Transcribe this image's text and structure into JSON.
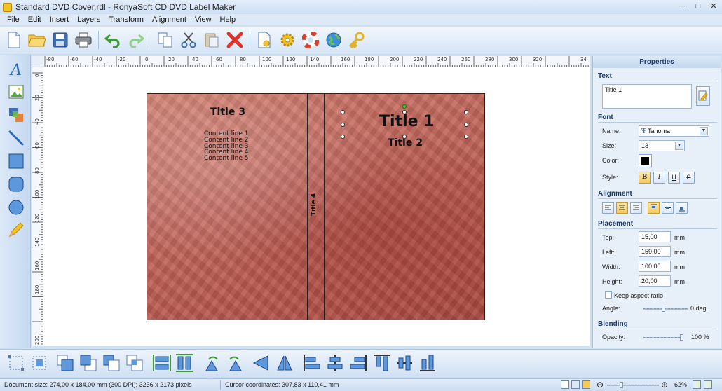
{
  "window": {
    "title": "Standard DVD Cover.rdl - RonyaSoft CD DVD Label Maker",
    "minimize": "─",
    "maximize": "□",
    "close": "✕"
  },
  "menu": [
    "File",
    "Edit",
    "Insert",
    "Layers",
    "Transform",
    "Alignment",
    "View",
    "Help"
  ],
  "toolbar": [
    {
      "name": "new-icon"
    },
    {
      "name": "open-icon"
    },
    {
      "name": "save-icon"
    },
    {
      "name": "print-icon"
    },
    {
      "name": "undo-icon"
    },
    {
      "name": "redo-icon"
    },
    {
      "name": "copy-icon"
    },
    {
      "name": "cut-icon"
    },
    {
      "name": "paste-icon"
    },
    {
      "name": "delete-icon"
    },
    {
      "name": "document-settings-icon"
    },
    {
      "name": "settings-gear-icon"
    },
    {
      "name": "help-lifebuoy-icon"
    },
    {
      "name": "web-globe-icon"
    },
    {
      "name": "register-key-icon"
    }
  ],
  "tools": [
    "text-tool-icon",
    "image-tool-icon",
    "layers-tool-icon",
    "line-tool-icon",
    "rectangle-tool-icon",
    "rounded-rectangle-tool-icon",
    "ellipse-tool-icon",
    "pencil-tool-icon"
  ],
  "ruler": {
    "h_labels": [
      "-80",
      "-60",
      "-40",
      "-20",
      "0",
      "20",
      "40",
      "60",
      "80",
      "100",
      "120",
      "140",
      "160",
      "180",
      "200",
      "220",
      "240",
      "260",
      "280",
      "300",
      "320",
      "34"
    ],
    "v_labels": [
      "0",
      "20",
      "40",
      "60",
      "80",
      "100",
      "120",
      "140",
      "160",
      "180",
      "200"
    ]
  },
  "cover": {
    "title3": "Title 3",
    "content_lines": [
      "Content line 1",
      "Content line 2",
      "Content line 3",
      "Content line 4",
      "Content line 5"
    ],
    "title4": "Title 4",
    "title1": "Title 1",
    "title2": "Title 2"
  },
  "properties": {
    "header": "Properties",
    "text_section": "Text",
    "text_value": "Title 1",
    "font_section": "Font",
    "name_label": "Name:",
    "font_name": "Tahoma",
    "size_label": "Size:",
    "font_size": "13",
    "color_label": "Color:",
    "color_value": "#000000",
    "style_label": "Style:",
    "style_buttons": [
      "B",
      "I",
      "U",
      "S"
    ],
    "alignment_section": "Alignment",
    "placement_section": "Placement",
    "top_label": "Top:",
    "top_value": "15,00",
    "left_label": "Left:",
    "left_value": "159,00",
    "width_label": "Width:",
    "width_value": "100,00",
    "height_label": "Height:",
    "height_value": "20,00",
    "unit": "mm",
    "keep_aspect_label": "Keep aspect ratio",
    "angle_label": "Angle:",
    "angle_value": "0 deg.",
    "blending_section": "Blending",
    "opacity_label": "Opacity:",
    "opacity_value": "100 %"
  },
  "bottom_tools": [
    "select-all-icon",
    "select-frame-icon",
    "bring-to-front-icon",
    "send-to-back-icon",
    "bring-forward-icon",
    "send-backward-icon",
    "same-width-icon",
    "same-height-icon",
    "rotate-left-icon",
    "rotate-right-icon",
    "flip-horizontal-icon",
    "flip-vertical-icon",
    "align-left-icon",
    "align-center-icon",
    "align-right-icon",
    "align-top-icon",
    "align-middle-icon",
    "align-bottom-icon"
  ],
  "status": {
    "doc_size": "Document size: 274,00 x 184,00 mm (300 DPI); 3236 x 2173 pixels",
    "cursor": "Cursor coordinates: 307,83 x 110,41 mm",
    "zoom": "62%",
    "zoom_out": "⊖",
    "zoom_in": "⊕"
  },
  "colors": {
    "accent": "#1e3b68",
    "cover_base": "#c2675c",
    "active_button": "#f6c95a"
  }
}
